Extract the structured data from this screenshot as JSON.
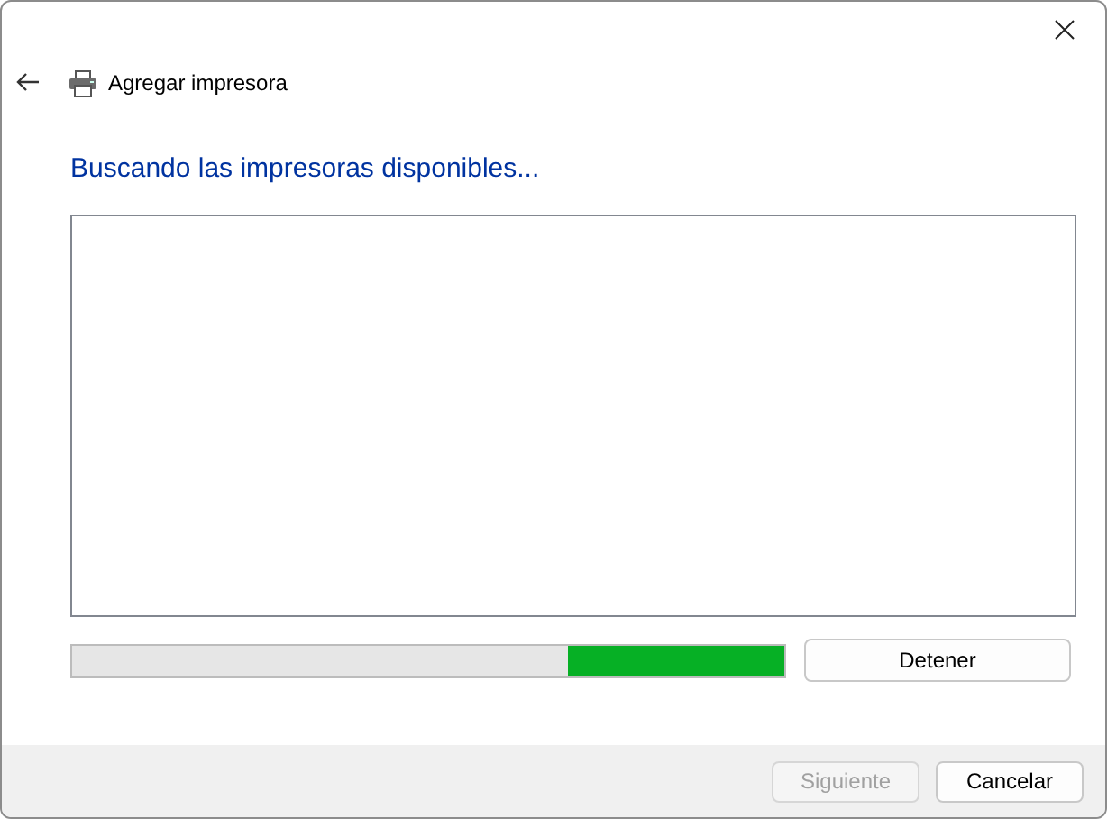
{
  "window": {
    "title": "Agregar impresora"
  },
  "heading": "Buscando las impresoras disponibles...",
  "progress": {
    "kind": "marquee"
  },
  "stop_button": {
    "label": "Detener"
  },
  "buttons": [
    {
      "label": "Siguiente",
      "disabled": true
    },
    {
      "label": "Cancelar",
      "disabled": false
    }
  ]
}
